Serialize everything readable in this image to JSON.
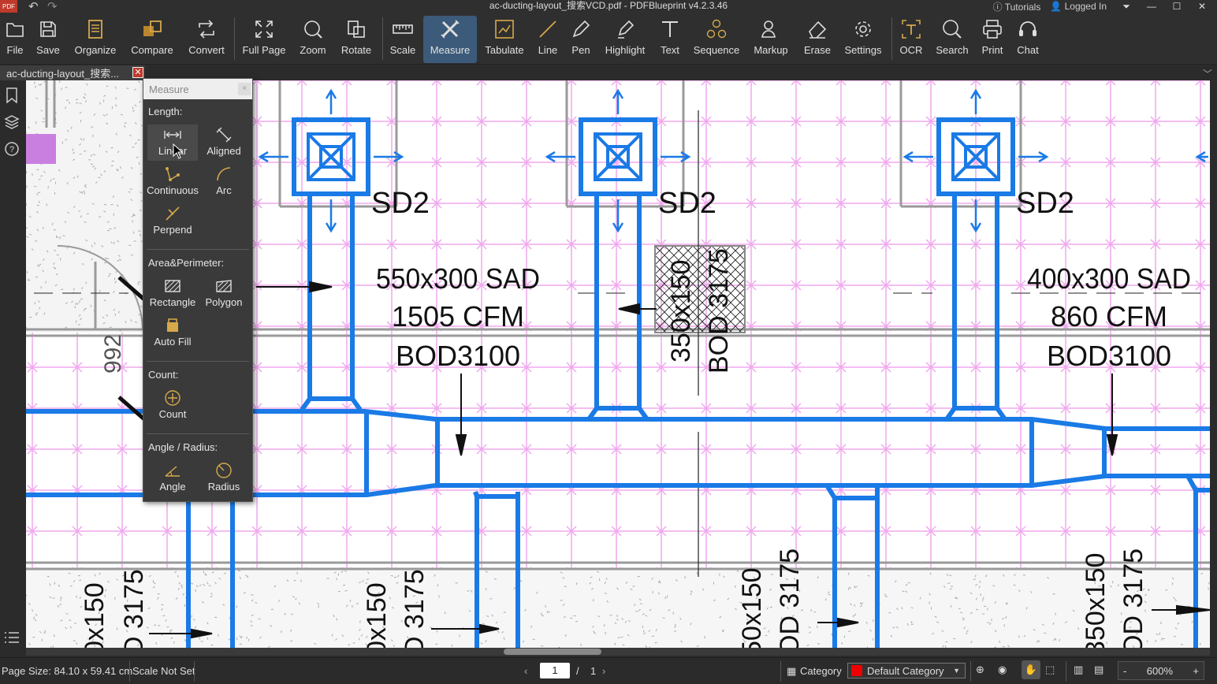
{
  "window": {
    "title": "ac-ducting-layout_搜索VCD.pdf - PDFBlueprint v4.2.3.46",
    "logo_text": "PDF",
    "tutorials": "Tutorials",
    "logged_in": "Logged In"
  },
  "toolbar": {
    "file": "File",
    "save": "Save",
    "organize": "Organize",
    "compare": "Compare",
    "convert": "Convert",
    "full_page": "Full Page",
    "zoom": "Zoom",
    "rotate": "Rotate",
    "scale": "Scale",
    "measure": "Measure",
    "tabulate": "Tabulate",
    "line": "Line",
    "pen": "Pen",
    "highlight": "Highlight",
    "text": "Text",
    "sequence": "Sequence",
    "markup": "Markup",
    "erase": "Erase",
    "settings": "Settings",
    "ocr": "OCR",
    "search": "Search",
    "print": "Print",
    "chat": "Chat"
  },
  "tab": {
    "label": "ac-ducting-layout_搜索..."
  },
  "measure_panel": {
    "title": "Measure",
    "length_heading": "Length:",
    "linear": "Linear",
    "aligned": "Aligned",
    "continuous": "Continuous",
    "arc": "Arc",
    "perpend": "Perpend",
    "area_heading": "Area&Perimeter:",
    "rectangle": "Rectangle",
    "polygon": "Polygon",
    "auto_fill": "Auto Fill",
    "count_heading": "Count:",
    "count": "Count",
    "angle_heading": "Angle / Radius:",
    "angle": "Angle",
    "radius": "Radius"
  },
  "drawing": {
    "diffuser_tag": "SD2",
    "duct_left_size": "550x300 SAD",
    "duct_left_cfm": "1505 CFM",
    "duct_left_bod": "BOD3100",
    "duct_right_size": "400x300 SAD",
    "duct_right_cfm": "860 CFM",
    "duct_right_bod": "BOD3100",
    "riser_size": "350x150",
    "riser_bod": "BOD 3175",
    "dimension_992": "992",
    "bottom_a_size": "0x150",
    "bottom_a_bod": "D 3175",
    "bottom_b_size": "0x150",
    "bottom_b_bod": "D 3175",
    "bottom_c_size": "50x150",
    "bottom_c_bod": "OD 3175",
    "bottom_d_size": "350x150",
    "bottom_d_bod": "OD 3175"
  },
  "status": {
    "page_size": "Page Size: 84.10 x 59.41 cm",
    "scale": "Scale Not Set",
    "page_current": "1",
    "page_separator": "/",
    "page_total": "1",
    "category_label": "Category",
    "category_value": "Default Category",
    "category_color": "#e00000",
    "zoom_minus": "-",
    "zoom_value": "600%",
    "zoom_plus": "+"
  },
  "colors": {
    "duct_blue": "#1a7ae6",
    "grid_pink": "#f0a8ee",
    "accent_active": "#3c5a7a"
  }
}
